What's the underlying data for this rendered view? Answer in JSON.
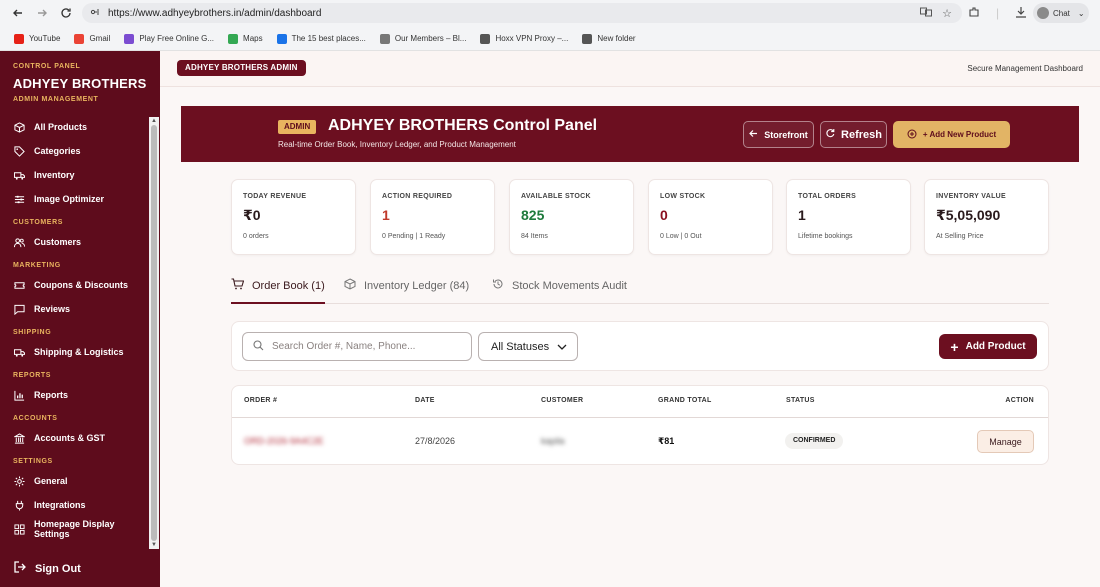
{
  "browser": {
    "url": "https://www.adhyeybrothers.in/admin/dashboard",
    "profile_label": "Chat",
    "bookmarks": [
      {
        "label": "YouTube",
        "color": "#e62117"
      },
      {
        "label": "Gmail",
        "color": "#ea4335"
      },
      {
        "label": "Play Free Online G...",
        "color": "#7b4cd1"
      },
      {
        "label": "Maps",
        "color": "#34a853"
      },
      {
        "label": "The 15 best places...",
        "color": "#1a73e8"
      },
      {
        "label": "Our Members – Bl...",
        "color": "#777777"
      },
      {
        "label": "Hoxx VPN Proxy –...",
        "color": "#555555"
      },
      {
        "label": "New folder",
        "color": "#555555"
      }
    ]
  },
  "sidebar": {
    "kicker": "CONTROL PANEL",
    "brand": "ADHYEY BROTHERS",
    "subtitle": "ADMIN MANAGEMENT",
    "items": [
      {
        "label": "All Products",
        "icon": "cube-icon"
      },
      {
        "label": "Categories",
        "icon": "tag-icon"
      },
      {
        "label": "Inventory",
        "icon": "truck-icon"
      },
      {
        "label": "Image Optimizer",
        "icon": "sliders-icon"
      }
    ],
    "sections": [
      {
        "title": "CUSTOMERS",
        "items": [
          {
            "label": "Customers",
            "icon": "users-icon"
          }
        ]
      },
      {
        "title": "MARKETING",
        "items": [
          {
            "label": "Coupons & Discounts",
            "icon": "ticket-icon"
          },
          {
            "label": "Reviews",
            "icon": "comment-icon"
          }
        ]
      },
      {
        "title": "SHIPPING",
        "items": [
          {
            "label": "Shipping & Logistics",
            "icon": "truck-icon"
          }
        ]
      },
      {
        "title": "REPORTS",
        "items": [
          {
            "label": "Reports",
            "icon": "bar-chart-icon"
          }
        ]
      },
      {
        "title": "ACCOUNTS",
        "items": [
          {
            "label": "Accounts & GST",
            "icon": "bank-icon"
          }
        ]
      },
      {
        "title": "SETTINGS",
        "items": [
          {
            "label": "General",
            "icon": "gear-icon"
          },
          {
            "label": "Integrations",
            "icon": "plug-icon"
          },
          {
            "label": "Homepage Display Settings",
            "icon": "grid-icon"
          }
        ]
      }
    ],
    "signout": "Sign Out"
  },
  "appbar": {
    "admin_label": "ADHYEY BROTHERS ADMIN",
    "right_text": "Secure Management Dashboard"
  },
  "banner": {
    "badge": "ADMIN",
    "title": "ADHYEY BROTHERS Control Panel",
    "subtitle": "Real-time Order Book, Inventory Ledger, and Product Management",
    "storefront": "Storefront",
    "refresh": "Refresh",
    "add_new": "+ Add New Product"
  },
  "stats": [
    {
      "label": "TODAY REVENUE",
      "value": "₹0",
      "sub": "0 orders",
      "color": "#2a1a1c"
    },
    {
      "label": "ACTION REQUIRED",
      "value": "1",
      "sub": "0 Pending | 1 Ready",
      "color": "#c0392b"
    },
    {
      "label": "AVAILABLE STOCK",
      "value": "825",
      "sub": "84 Items",
      "color": "#1e7a3c"
    },
    {
      "label": "LOW STOCK",
      "value": "0",
      "sub": "0 Low | 0 Out",
      "color": "#8a1020"
    },
    {
      "label": "TOTAL ORDERS",
      "value": "1",
      "sub": "Lifetime bookings",
      "color": "#2a1a1c"
    },
    {
      "label": "INVENTORY VALUE",
      "value": "₹5,05,090",
      "sub": "At Selling Price",
      "color": "#2a1a1c"
    }
  ],
  "tabs": [
    {
      "label": "Order Book (1)",
      "icon": "cart-icon",
      "active": true
    },
    {
      "label": "Inventory Ledger (84)",
      "icon": "box-icon",
      "active": false
    },
    {
      "label": "Stock Movements Audit",
      "icon": "history-icon",
      "active": false
    }
  ],
  "filter": {
    "search_placeholder": "Search Order #, Name, Phone...",
    "status_selected": "All Statuses",
    "add_product": "Add Product"
  },
  "table": {
    "headers": [
      "ORDER #",
      "DATE",
      "CUSTOMER",
      "GRAND TOTAL",
      "STATUS",
      "ACTION"
    ],
    "rows": [
      {
        "order": "ORD-2026-9A4C2E",
        "date": "27/8/2026",
        "customer": "kapila",
        "total": "₹81",
        "status": "CONFIRMED",
        "action": "Manage"
      }
    ]
  }
}
